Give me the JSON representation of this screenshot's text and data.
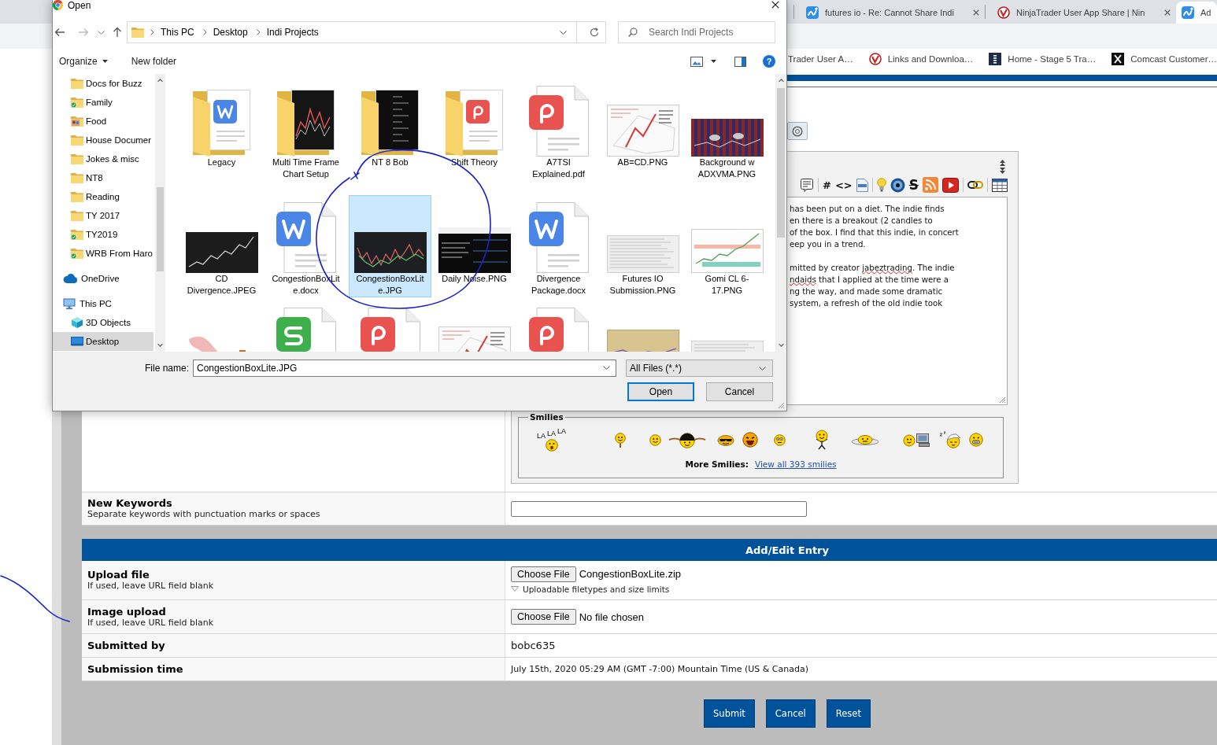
{
  "browser": {
    "tabs": [
      {
        "title": "futures io - Re: Cannot Share Indi",
        "kind": "wave",
        "selected": false
      },
      {
        "title": "NinjaTrader User App Share | Nin",
        "kind": "ring",
        "selected": false
      },
      {
        "title": "Ad",
        "kind": "wave",
        "selected": true
      }
    ],
    "bookmarks": [
      {
        "label": "Trader User A…"
      },
      {
        "label": "Links and Downloa…",
        "kind": "ring"
      },
      {
        "label": "Home - Stage 5 Tra…",
        "kind": "bars"
      },
      {
        "label": "Comcast Customer…",
        "kind": "cross"
      }
    ]
  },
  "page": {
    "editor": {
      "toolbar": [
        {
          "kind": "form"
        },
        {
          "kind": "separator"
        },
        {
          "kind": "glyph",
          "glyph": "#"
        },
        {
          "kind": "glyph",
          "glyph": "<>"
        },
        {
          "kind": "php"
        },
        {
          "kind": "separator"
        },
        {
          "kind": "bulb"
        },
        {
          "kind": "disc"
        },
        {
          "kind": "strike",
          "glyph": "S"
        },
        {
          "kind": "feed"
        },
        {
          "kind": "video"
        },
        {
          "kind": "separator"
        },
        {
          "kind": "link"
        },
        {
          "kind": "separator"
        },
        {
          "kind": "table"
        }
      ],
      "paragraphs": [
        [
          [
            {
              "text": "has been put on a diet. The indie finds",
              "misspelled": false
            }
          ],
          [
            {
              "text": "en there is a breakout (2 candles to",
              "misspelled": false
            }
          ],
          [
            {
              "text": "of the box. I find that this indie, in concert",
              "misspelled": false
            }
          ],
          [
            {
              "text": "eep you in a trend.",
              "misspelled": false
            }
          ]
        ],
        [
          [
            {
              "text": "mitted by creator ",
              "misspelled": false
            },
            {
              "text": "jabeztrading",
              "misspelled": true
            },
            {
              "text": ". The indie",
              "misspelled": false
            }
          ],
          [
            {
              "text": "ndaids",
              "misspelled": true
            },
            {
              "text": " that I applied at the time were a",
              "misspelled": false
            }
          ],
          [
            {
              "text": "ng the way, and made some dramatic",
              "misspelled": false
            }
          ],
          [
            {
              "text": "system, a refresh of the old indie took",
              "misspelled": false
            }
          ]
        ]
      ],
      "smilies_legend": "Smilies",
      "smilies": [
        {
          "kind": "singing",
          "sounds": [
            "LA",
            "LA",
            "LA"
          ]
        },
        {
          "kind": "holding"
        },
        {
          "kind": "smile"
        },
        {
          "kind": "winged"
        },
        {
          "kind": "cool"
        },
        {
          "kind": "laughing"
        },
        {
          "kind": "worried"
        },
        {
          "kind": "dancing"
        },
        {
          "kind": "flat"
        },
        {
          "kind": "computer"
        },
        {
          "kind": "sleeping"
        },
        {
          "kind": "grin"
        }
      ],
      "more_label": "More Smilies:",
      "more_link": "View all 393 smilies"
    },
    "keywords": {
      "title": "New Keywords",
      "hint": "Separate keywords with punctuation marks or spaces"
    },
    "section_title": "Add/Edit Entry",
    "rows": [
      {
        "kind": "upload",
        "title": "Upload file",
        "hint": "If used, leave URL field blank",
        "button": "Choose File",
        "file": "CongestionBoxLite.zip",
        "note": "Uploadable filetypes and size limits"
      },
      {
        "kind": "upload",
        "title": "Image upload",
        "hint": "If used, leave URL field blank",
        "button": "Choose File",
        "file": "No file chosen"
      },
      {
        "kind": "value",
        "title": "Submitted by",
        "value": "bobc635"
      },
      {
        "kind": "datetime",
        "title": "Submission time",
        "value": "July 15th, 2020 05:29 AM (GMT -7:00) Mountain Time (US & Canada)"
      }
    ],
    "buttons": [
      "Submit",
      "Cancel",
      "Reset"
    ]
  },
  "dialog": {
    "title": "Open",
    "breadcrumb": [
      "This PC",
      "Desktop",
      "Indi Projects"
    ],
    "search": {
      "placeholder": "Search Indi Projects"
    },
    "toolbar": {
      "organize": "Organize",
      "new_folder": "New folder",
      "help": "?"
    },
    "sidebar": {
      "folders": [
        {
          "label": "Docs for Buzz",
          "kind": "folder",
          "synced": false,
          "selected": false
        },
        {
          "label": "Family",
          "kind": "folder",
          "synced": true,
          "selected": false
        },
        {
          "label": "Food",
          "kind": "photos",
          "synced": false,
          "selected": false
        },
        {
          "label": "House Documer",
          "kind": "folder",
          "synced": false,
          "selected": false
        },
        {
          "label": "Jokes & misc",
          "kind": "folder",
          "synced": false,
          "selected": false
        },
        {
          "label": "NT8",
          "kind": "folder",
          "synced": false,
          "selected": false
        },
        {
          "label": "Reading",
          "kind": "folder",
          "synced": false,
          "selected": false
        },
        {
          "label": "TY 2017",
          "kind": "folder",
          "synced": false,
          "selected": false
        },
        {
          "label": "TY2019",
          "kind": "folder",
          "synced": true,
          "selected": false
        },
        {
          "label": "WRB From Haro",
          "kind": "folder",
          "synced": true,
          "selected": false
        }
      ],
      "locations": [
        {
          "label": "OneDrive",
          "kind": "cloud",
          "selected": false
        },
        {
          "label": "This PC",
          "kind": "computer",
          "selected": false,
          "children": [
            {
              "label": "3D Objects",
              "kind": "cube",
              "selected": false
            },
            {
              "label": "Desktop",
              "kind": "desktop",
              "selected": true
            }
          ]
        }
      ]
    },
    "files": [
      {
        "name": "Legacy",
        "kind": "docfolder",
        "selected": false
      },
      {
        "name": "Multi Time Frame Chart Setup",
        "kind": "chartfolder",
        "selected": false
      },
      {
        "name": "NT 8 Bob",
        "kind": "darkfolder",
        "selected": false
      },
      {
        "name": "Shift Theory",
        "kind": "pdffolder",
        "selected": false
      },
      {
        "name": "A7TSI Explained.pdf",
        "kind": "pdf",
        "selected": false
      },
      {
        "name": "AB=CD.PNG",
        "kind": "lightshot",
        "selected": false
      },
      {
        "name": "Background w ADXVMA.PNG",
        "kind": "stripedshot",
        "selected": false
      },
      {
        "name": "CD Divergence.JPEG",
        "kind": "darkshot",
        "selected": false
      },
      {
        "name": "CongestionBoxLite.docx",
        "kind": "word",
        "selected": false
      },
      {
        "name": "CongestionBoxLite.JPG",
        "kind": "candleshot",
        "selected": true
      },
      {
        "name": "Daily Noise.PNG",
        "kind": "panelshot",
        "selected": false
      },
      {
        "name": "Divergence Package.docx",
        "kind": "word",
        "selected": false
      },
      {
        "name": "Futures IO Submission.PNG",
        "kind": "scanshot",
        "selected": false
      },
      {
        "name": "Gomi CL 6-17.PNG",
        "kind": "bandshot",
        "selected": false
      },
      {
        "kind": "photo",
        "selected": false
      },
      {
        "kind": "sheet",
        "selected": false
      },
      {
        "kind": "pdf",
        "selected": false
      },
      {
        "kind": "lightshot",
        "selected": false
      },
      {
        "kind": "pdf",
        "selected": false
      },
      {
        "kind": "tanshot",
        "selected": false
      },
      {
        "kind": "scanshot",
        "selected": false
      }
    ],
    "file_name": {
      "label": "File name:",
      "value": "CongestionBoxLite.JPG"
    },
    "file_type": "All Files (*.*)",
    "buttons": [
      {
        "label": "Open",
        "default": true
      },
      {
        "label": "Cancel",
        "default": false
      }
    ]
  }
}
